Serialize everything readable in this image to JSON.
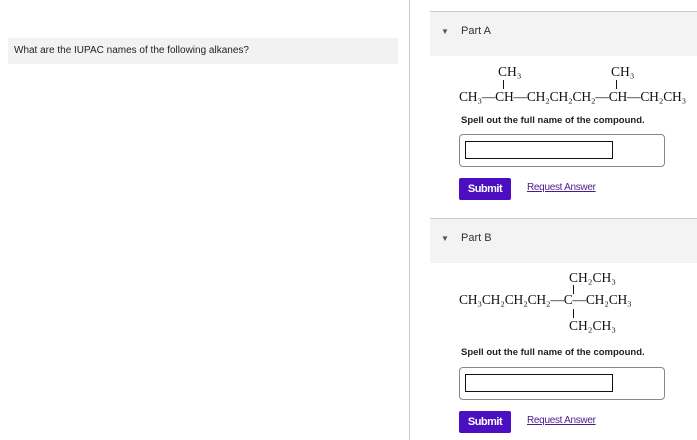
{
  "question": "What are the IUPAC names of the following alkanes?",
  "parts": [
    {
      "label": "Part A",
      "formula": {
        "main": "CH₃—CH—CH₂CH₂CH₂—CH—CH₂CH₃",
        "branch1": "CH₃",
        "branch2": "CH₃"
      },
      "prompt": "Spell out the full name of the compound.",
      "answer_value": "",
      "submit_label": "Submit",
      "request_label": "Request Answer"
    },
    {
      "label": "Part B",
      "formula": {
        "main": "CH₃CH₂CH₂CH₂—C—CH₂CH₃",
        "branch_top": "CH₂CH₃",
        "branch_bottom": "CH₂CH₃"
      },
      "prompt": "Spell out the full name of the compound.",
      "answer_value": "",
      "submit_label": "Submit",
      "request_label": "Request Answer"
    }
  ]
}
